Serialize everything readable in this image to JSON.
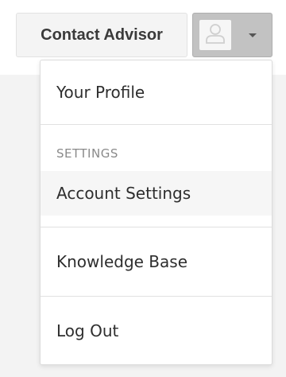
{
  "header": {
    "contact_button_label": "Contact Advisor",
    "avatar_icon": "user-icon",
    "dropdown_icon": "caret-down-icon"
  },
  "account_menu": {
    "profile_label": "Your Profile",
    "settings_header": "SETTINGS",
    "account_settings_label": "Account Settings",
    "knowledge_base_label": "Knowledge Base",
    "log_out_label": "Log Out"
  },
  "colors": {
    "page_background": "#f3f3f3",
    "toggle_background": "#c2c2c2",
    "hover_row_background": "#f6f6f6",
    "section_header_text": "#8a8a8a"
  }
}
